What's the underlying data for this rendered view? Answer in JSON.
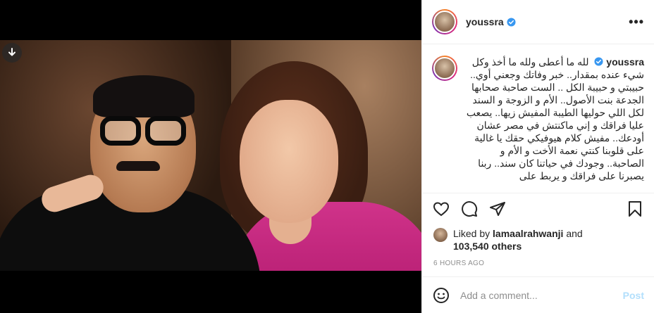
{
  "author": {
    "username": "youssra",
    "verified": true
  },
  "caption": {
    "username": "youssra",
    "text": "لله ما أعطى ولله ما أخذ وكل شيء عنده بمقدار.. خبر وفاتك وجعني أوي.. حبيبتي و حبيبة الكل .. الست صاحبة صحابها الجدعة بنت الأصول.. الأم و الزوجة و السند لكل اللي حوليها الطيبة المفيش زيها.. يصعب عليا فراقك و إني ماكنتش في مصر عشان أودعك.. مفيش كلام هيوفيكي حقك يا غالية على قلوبنا كنتي نعمة الأخت و الأم و الصاحبة.. وجودك في حياتنا كان سند.. ربنا يصبرنا على فراقك و يربط على"
  },
  "likes": {
    "prefix": "Liked by",
    "liker": "lamaalrahwanji",
    "conjunction": "and",
    "others": "103,540 others"
  },
  "timestamp": "6 HOURS AGO",
  "comment": {
    "placeholder": "Add a comment...",
    "post_label": "Post"
  },
  "more_label": "•••",
  "icons": [
    "download-icon",
    "heart-icon",
    "comment-icon",
    "share-icon",
    "bookmark-icon",
    "emoji-icon",
    "verified-icon"
  ],
  "colors": {
    "verified": "#3897f0",
    "post_disabled": "#b2dffc",
    "dress": "#c8287e"
  }
}
